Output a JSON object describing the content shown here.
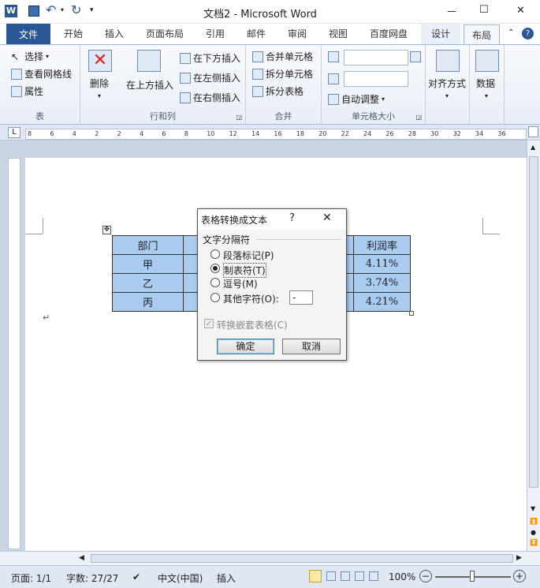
{
  "titlebar": {
    "title": "文档2 - Microsoft Word",
    "min": "—",
    "max": "☐",
    "close": "✕"
  },
  "tabs": [
    "文件",
    "开始",
    "插入",
    "页面布局",
    "引用",
    "邮件",
    "审阅",
    "视图",
    "百度网盘",
    "设计",
    "布局"
  ],
  "ribbon": {
    "table_group": {
      "label": "表",
      "select": "选择",
      "gridlines": "查看网格线",
      "properties": "属性"
    },
    "rowscols_group": {
      "label": "行和列",
      "delete": "删除",
      "insert_above": "在上方插入",
      "insert_below": "在下方插入",
      "insert_left": "在左侧插入",
      "insert_right": "在右侧插入"
    },
    "merge_group": {
      "label": "合并",
      "merge_cells": "合并单元格",
      "split_cells": "拆分单元格",
      "split_table": "拆分表格"
    },
    "cellsize_group": {
      "label": "单元格大小",
      "autofit": "自动调整"
    },
    "align": "对齐方式",
    "data": "数据"
  },
  "ruler_numbers": [
    "8",
    "6",
    "4",
    "2",
    "2",
    "4",
    "6",
    "8",
    "10",
    "12",
    "14",
    "16",
    "18",
    "20",
    "22",
    "24",
    "26",
    "28",
    "30",
    "32",
    "34",
    "36"
  ],
  "table": {
    "rows": [
      [
        "部门",
        "",
        "利润率"
      ],
      [
        "甲",
        "",
        "4.11%"
      ],
      [
        "乙",
        "",
        "3.74%"
      ],
      [
        "丙",
        "",
        "4.21%"
      ]
    ]
  },
  "dialog": {
    "title": "表格转换成文本",
    "help": "?",
    "close": "✕",
    "group_label": "文字分隔符",
    "options": [
      "段落标记(P)",
      "制表符(T)",
      "逗号(M)",
      "其他字符(O):"
    ],
    "selected": "制表符(T)",
    "other_value": "-",
    "nested_label": "转换嵌套表格(C)",
    "ok": "确定",
    "cancel": "取消"
  },
  "status": {
    "page": "页面: 1/1",
    "words": "字数: 27/27",
    "lang": "中文(中国)",
    "mode": "插入",
    "zoom": "100%"
  }
}
